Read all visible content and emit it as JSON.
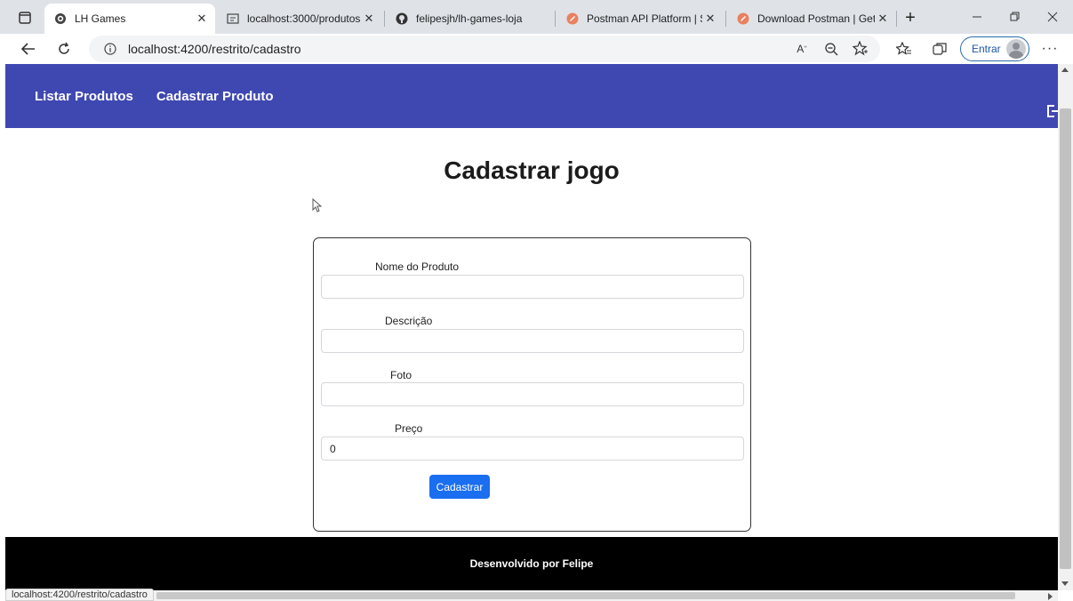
{
  "browser": {
    "tabs": [
      {
        "label": "LH Games",
        "icon": "angular-icon",
        "active": true
      },
      {
        "label": "localhost:3000/produtos",
        "icon": "page-icon",
        "active": false
      },
      {
        "label": "felipesjh/lh-games-loja",
        "icon": "github-icon",
        "active": false
      },
      {
        "label": "Postman API Platform | Sig",
        "icon": "postman-icon",
        "active": false
      },
      {
        "label": "Download Postman | Get S",
        "icon": "postman-icon",
        "active": false
      }
    ],
    "url": "localhost:4200/restrito/cadastro",
    "signin_label": "Entrar",
    "status_url": "localhost:4200/restrito/cadastro"
  },
  "navbar": {
    "links": [
      "Listar Produtos",
      "Cadastrar Produto"
    ]
  },
  "page": {
    "title": "Cadastrar jogo"
  },
  "form": {
    "fields": [
      {
        "label": "Nome do Produto",
        "value": ""
      },
      {
        "label": "Descrição",
        "value": ""
      },
      {
        "label": "Foto",
        "value": ""
      },
      {
        "label": "Preço",
        "value": "0"
      }
    ],
    "submit_label": "Cadastrar"
  },
  "footer": {
    "text": "Desenvolvido por Felipe"
  },
  "colors": {
    "navbar": "#3f48b1",
    "button": "#1a6ef0",
    "footer": "#000000"
  }
}
